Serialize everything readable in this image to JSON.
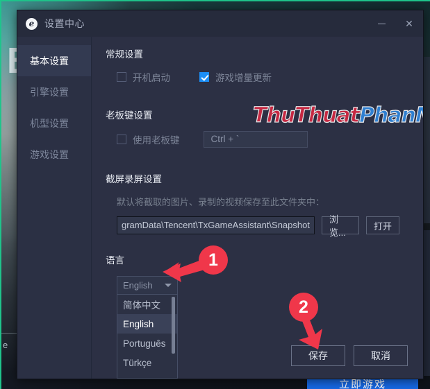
{
  "window": {
    "title": "设置中心",
    "logo_glyph": "e",
    "minimize_label": "最小化",
    "close_label": "关闭"
  },
  "sidebar": {
    "items": [
      {
        "label": "基本设置",
        "active": true
      },
      {
        "label": "引擎设置",
        "active": false
      },
      {
        "label": "机型设置",
        "active": false
      },
      {
        "label": "游戏设置",
        "active": false
      }
    ]
  },
  "sections": {
    "general": {
      "title": "常规设置",
      "checkbox_autostart": {
        "label": "开机启动",
        "checked": false
      },
      "checkbox_incremental": {
        "label": "游戏增量更新",
        "checked": true
      }
    },
    "bosskey": {
      "title": "老板键设置",
      "checkbox_usebosskey": {
        "label": "使用老板键",
        "checked": false
      },
      "hotkey_value": "Ctrl + `"
    },
    "capture": {
      "title": "截屏录屏设置",
      "hint": "默认将截取的图片、录制的视频保存至此文件夹中：",
      "path_value": "gramData\\Tencent\\TxGameAssistant\\Snapshot",
      "browse_label": "浏览...",
      "open_label": "打开"
    },
    "language": {
      "title": "语言",
      "selected": "English",
      "options": [
        {
          "label": "简体中文",
          "selected": false
        },
        {
          "label": "English",
          "selected": true
        },
        {
          "label": "Português",
          "selected": false
        },
        {
          "label": "Türkçe",
          "selected": false
        }
      ]
    }
  },
  "footer": {
    "save_label": "保存",
    "cancel_label": "取消"
  },
  "watermark": {
    "part_red": "ThuThuat",
    "part_blue": "PhanMem.vn",
    "color_red": "#c62842",
    "color_blue": "#2f7fd0"
  },
  "annotations": [
    {
      "number": "1",
      "color": "#f0374a"
    },
    {
      "number": "2",
      "color": "#f0374a"
    }
  ],
  "background": {
    "letter": "B",
    "small_text": "e",
    "blue_button_label": "立即游戏",
    "accent_border": "#1fc48b"
  }
}
